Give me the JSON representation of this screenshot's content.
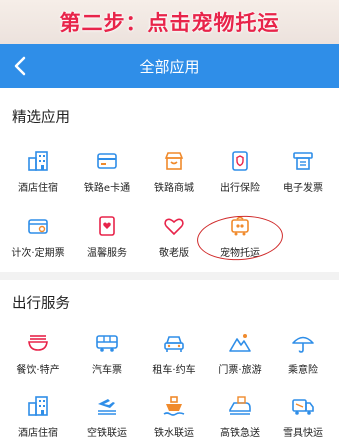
{
  "banner": {
    "text": "第二步：点击宠物托运"
  },
  "header": {
    "title": "全部应用"
  },
  "featured": {
    "title": "精选应用",
    "items": [
      {
        "label": "酒店住宿",
        "icon": "hotel-icon"
      },
      {
        "label": "铁路e卡通",
        "icon": "card-icon"
      },
      {
        "label": "铁路商城",
        "icon": "shop-icon"
      },
      {
        "label": "出行保险",
        "icon": "shield-icon"
      },
      {
        "label": "电子发票",
        "icon": "invoice-icon"
      },
      {
        "label": "计次·定期票",
        "icon": "ticket-icon"
      },
      {
        "label": "温馨服务",
        "icon": "heart-box-icon"
      },
      {
        "label": "敬老版",
        "icon": "heart-icon"
      },
      {
        "label": "宠物托运",
        "icon": "pet-carrier-icon"
      }
    ]
  },
  "travel": {
    "title": "出行服务",
    "items": [
      {
        "label": "餐饮·特产",
        "icon": "bowl-icon"
      },
      {
        "label": "汽车票",
        "icon": "bus-icon"
      },
      {
        "label": "租车·约车",
        "icon": "car-icon"
      },
      {
        "label": "门票·旅游",
        "icon": "mountain-icon"
      },
      {
        "label": "乘意险",
        "icon": "umbrella-icon"
      },
      {
        "label": "酒店住宿",
        "icon": "hotel-icon"
      },
      {
        "label": "空铁联运",
        "icon": "plane-rail-icon"
      },
      {
        "label": "铁水联运",
        "icon": "ship-icon"
      },
      {
        "label": "高铁急送",
        "icon": "express-icon"
      },
      {
        "label": "雪具快运",
        "icon": "ski-truck-icon"
      }
    ]
  },
  "colors": {
    "accent": "#2f8ee8",
    "orange": "#f08a2c",
    "red": "#e8244a",
    "highlight": "#d02b2b"
  }
}
